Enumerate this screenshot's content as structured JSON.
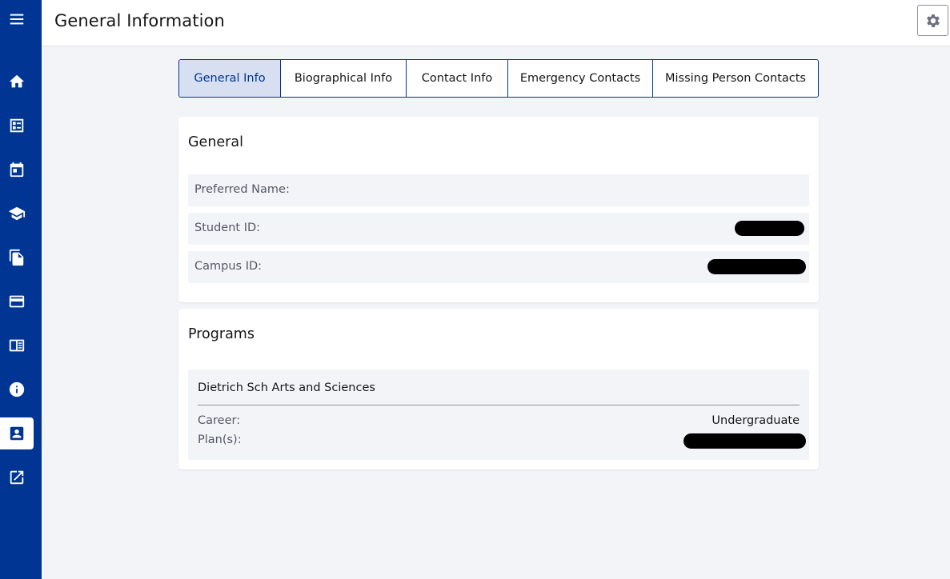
{
  "header": {
    "title": "General Information",
    "settings_icon": "gear-icon"
  },
  "sidebar": {
    "items": [
      {
        "name": "menu",
        "icon": "hamburger-icon"
      },
      {
        "name": "home",
        "icon": "home-icon"
      },
      {
        "name": "dashboard",
        "icon": "checklist-icon"
      },
      {
        "name": "calendar",
        "icon": "calendar-icon"
      },
      {
        "name": "academics",
        "icon": "graduation-cap-icon"
      },
      {
        "name": "documents",
        "icon": "documents-icon"
      },
      {
        "name": "finances",
        "icon": "credit-card-icon"
      },
      {
        "name": "news",
        "icon": "newspaper-icon"
      },
      {
        "name": "info",
        "icon": "info-icon"
      },
      {
        "name": "profile",
        "icon": "contact-card-icon",
        "active": true
      },
      {
        "name": "external",
        "icon": "external-link-icon"
      }
    ]
  },
  "tabs": [
    {
      "label": "General Info",
      "active": true
    },
    {
      "label": "Biographical Info"
    },
    {
      "label": "Contact Info"
    },
    {
      "label": "Emergency Contacts"
    },
    {
      "label": "Missing Person Contacts"
    }
  ],
  "general": {
    "title": "General",
    "rows": [
      {
        "label": "Preferred Name:",
        "value": ""
      },
      {
        "label": "Student ID:",
        "value_redacted": true
      },
      {
        "label": "Campus ID:",
        "value_redacted": true
      }
    ]
  },
  "programs": {
    "title": "Programs",
    "items": [
      {
        "name": "Dietrich Sch Arts and Sciences",
        "career_label": "Career:",
        "career_value": "Undergraduate",
        "plans_label": "Plan(s):",
        "plans_redacted": true
      }
    ]
  },
  "colors": {
    "brand": "#003594",
    "active_tab_bg": "#d8dff0",
    "page_bg": "#f3f4f7",
    "row_bg": "#f3f4f7",
    "redaction": "#000000"
  }
}
